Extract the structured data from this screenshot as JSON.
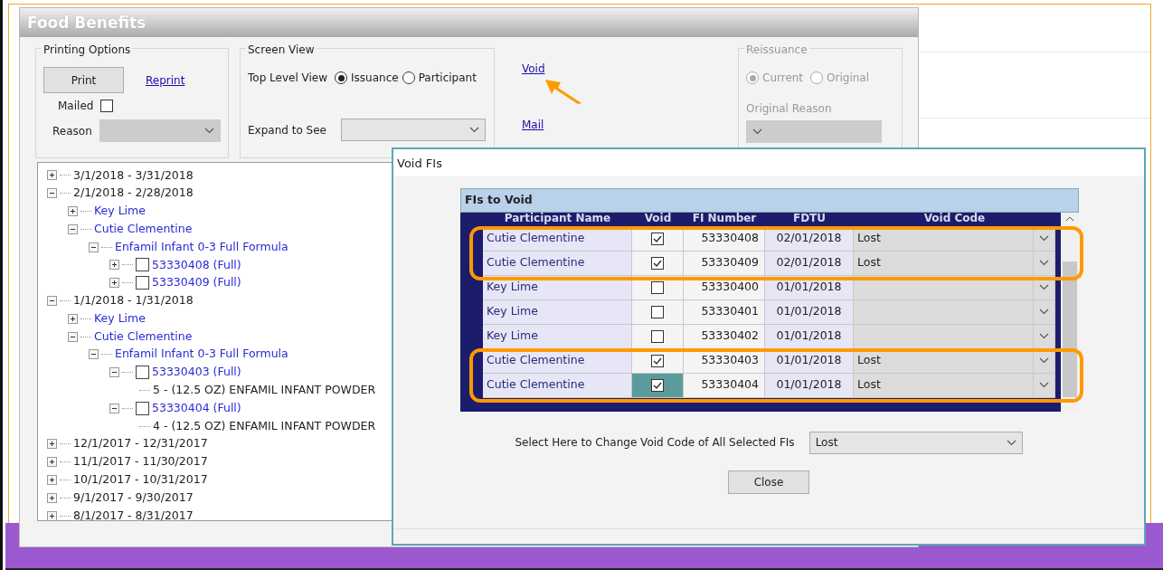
{
  "window": {
    "title": "Food Benefits"
  },
  "printing_options": {
    "title": "Printing Options",
    "print_button": "Print",
    "reprint_link": "Reprint",
    "mailed": {
      "label": "Mailed",
      "checked": false
    },
    "reason": {
      "label": "Reason",
      "disabled": true
    }
  },
  "screen_view": {
    "title": "Screen View",
    "top_level_label": "Top Level View",
    "options": [
      {
        "label": "Issuance",
        "selected": true
      },
      {
        "label": "Participant",
        "selected": false
      }
    ],
    "expand_label": "Expand to See"
  },
  "links": [
    "Void",
    "Mail"
  ],
  "reissuance": {
    "title": "Reissuance",
    "disabled": true,
    "options": [
      {
        "label": "Current",
        "selected": true
      },
      {
        "label": "Original",
        "selected": false
      }
    ],
    "reason_label": "Original Reason"
  },
  "tree": [
    {
      "kind": "period",
      "label": "3/1/2018 - 3/31/2018",
      "expanded": false
    },
    {
      "kind": "period",
      "label": "2/1/2018 - 2/28/2018",
      "expanded": true,
      "children": [
        {
          "kind": "participant",
          "label": "Key Lime",
          "expanded": false
        },
        {
          "kind": "participant",
          "label": "Cutie Clementine",
          "expanded": true,
          "children": [
            {
              "kind": "formula",
              "label": "Enfamil Infant 0-3 Full Formula",
              "expanded": true,
              "children": [
                {
                  "kind": "fi",
                  "label": "53330408 (Full)",
                  "expanded": false,
                  "checked": false
                },
                {
                  "kind": "fi",
                  "label": "53330409 (Full)",
                  "expanded": false,
                  "checked": false
                }
              ]
            }
          ]
        }
      ]
    },
    {
      "kind": "period",
      "label": "1/1/2018 - 1/31/2018",
      "expanded": true,
      "children": [
        {
          "kind": "participant",
          "label": "Key Lime",
          "expanded": false
        },
        {
          "kind": "participant",
          "label": "Cutie Clementine",
          "expanded": true,
          "children": [
            {
              "kind": "formula",
              "label": "Enfamil Infant 0-3 Full Formula",
              "expanded": true,
              "children": [
                {
                  "kind": "fi",
                  "label": "53330403 (Full)",
                  "expanded": true,
                  "checked": false,
                  "children": [
                    {
                      "kind": "item",
                      "label": "5 - (12.5 OZ) ENFAMIL INFANT POWDER"
                    }
                  ]
                },
                {
                  "kind": "fi",
                  "label": "53330404 (Full)",
                  "expanded": true,
                  "checked": false,
                  "children": [
                    {
                      "kind": "item",
                      "label": "4 - (12.5 OZ) ENFAMIL INFANT POWDER"
                    }
                  ]
                }
              ]
            }
          ]
        }
      ]
    },
    {
      "kind": "period",
      "label": "12/1/2017 - 12/31/2017",
      "expanded": false
    },
    {
      "kind": "period",
      "label": "11/1/2017 - 11/30/2017",
      "expanded": false
    },
    {
      "kind": "period",
      "label": "10/1/2017 - 10/31/2017",
      "expanded": false
    },
    {
      "kind": "period",
      "label": "9/1/2017 - 9/30/2017",
      "expanded": false
    },
    {
      "kind": "period",
      "label": "8/1/2017 - 8/31/2017",
      "expanded": false
    }
  ],
  "dialog": {
    "title": "Void FIs",
    "group_title": "FIs to Void",
    "columns": [
      "Participant Name",
      "Void",
      "FI Number",
      "FDTU",
      "Void Code"
    ],
    "rows": [
      {
        "name": "Cutie Clementine",
        "void": true,
        "fi_number": "53330408",
        "fdtu": "02/01/2018",
        "void_code": "Lost",
        "focused": false,
        "highlighted": true
      },
      {
        "name": "Cutie Clementine",
        "void": true,
        "fi_number": "53330409",
        "fdtu": "02/01/2018",
        "void_code": "Lost",
        "focused": false,
        "highlighted": true
      },
      {
        "name": "Key Lime",
        "void": false,
        "fi_number": "53330400",
        "fdtu": "01/01/2018",
        "focused": false,
        "highlighted": false
      },
      {
        "name": "Key Lime",
        "void": false,
        "fi_number": "53330401",
        "fdtu": "01/01/2018",
        "focused": false,
        "highlighted": false
      },
      {
        "name": "Key Lime",
        "void": false,
        "fi_number": "53330402",
        "fdtu": "01/01/2018",
        "focused": false,
        "highlighted": false
      },
      {
        "name": "Cutie Clementine",
        "void": true,
        "fi_number": "53330403",
        "fdtu": "01/01/2018",
        "void_code": "Lost",
        "focused": false,
        "highlighted": true
      },
      {
        "name": "Cutie Clementine",
        "void": true,
        "fi_number": "53330404",
        "fdtu": "01/01/2018",
        "void_code": "Lost",
        "focused": true,
        "highlighted": true
      }
    ],
    "change_all_label": "Select Here to Change Void Code of All Selected FIs",
    "change_all_value": "Lost",
    "close_button": "Close"
  }
}
